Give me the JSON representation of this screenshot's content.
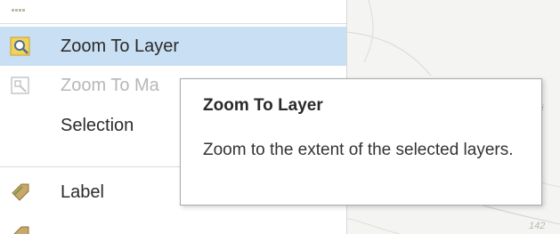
{
  "menu": {
    "items": [
      {
        "label": "Zoom To Layer",
        "icon": "zoom-to-layer-icon",
        "state": "active"
      },
      {
        "label": "Zoom To Ma",
        "icon": "zoom-to-make-visible-icon",
        "state": "disabled"
      },
      {
        "label": "Selection",
        "icon": "",
        "state": "normal"
      },
      {
        "label": "Label",
        "icon": "label-icon",
        "state": "normal"
      }
    ]
  },
  "tooltip": {
    "title": "Zoom To Layer",
    "body": "Zoom to the extent of the selected layers."
  },
  "map": {
    "labels": [
      "fi",
      "142"
    ]
  },
  "colors": {
    "active_row": "#c9dff3",
    "zoom_icon": "#e8c54f"
  }
}
